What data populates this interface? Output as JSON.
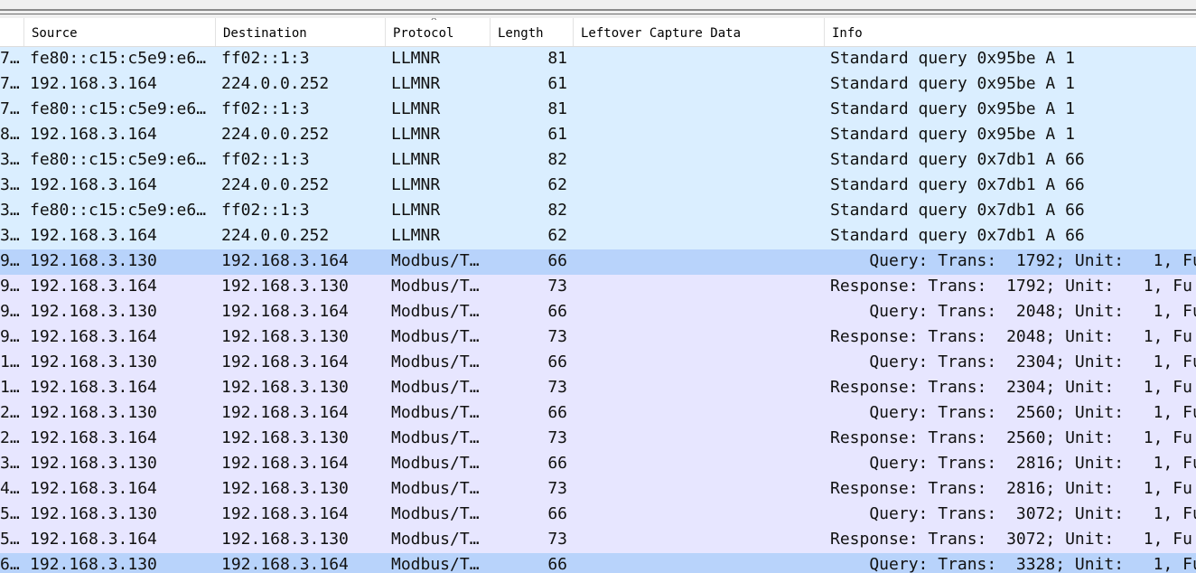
{
  "columns": {
    "no": "",
    "source": "Source",
    "destination": "Destination",
    "protocol": "Protocol",
    "length": "Length",
    "leftover": "Leftover Capture Data",
    "info": "Info"
  },
  "sort_indicator": "^",
  "colors": {
    "llmnr_row": "#daeeff",
    "modbus_row": "#e7e6ff",
    "selected_row": "#b8d3fb"
  },
  "rows": [
    {
      "no": "7…",
      "source": "fe80::c15:c5e9:e6…",
      "destination": "ff02::1:3",
      "protocol": "LLMNR",
      "length": "81",
      "leftover": "",
      "info": "Standard query 0x95be A 1",
      "kind": "llmnr"
    },
    {
      "no": "7…",
      "source": "192.168.3.164",
      "destination": "224.0.0.252",
      "protocol": "LLMNR",
      "length": "61",
      "leftover": "",
      "info": "Standard query 0x95be A 1",
      "kind": "llmnr"
    },
    {
      "no": "7…",
      "source": "fe80::c15:c5e9:e6…",
      "destination": "ff02::1:3",
      "protocol": "LLMNR",
      "length": "81",
      "leftover": "",
      "info": "Standard query 0x95be A 1",
      "kind": "llmnr"
    },
    {
      "no": "8…",
      "source": "192.168.3.164",
      "destination": "224.0.0.252",
      "protocol": "LLMNR",
      "length": "61",
      "leftover": "",
      "info": "Standard query 0x95be A 1",
      "kind": "llmnr"
    },
    {
      "no": "3…",
      "source": "fe80::c15:c5e9:e6…",
      "destination": "ff02::1:3",
      "protocol": "LLMNR",
      "length": "82",
      "leftover": "",
      "info": "Standard query 0x7db1 A 66",
      "kind": "llmnr"
    },
    {
      "no": "3…",
      "source": "192.168.3.164",
      "destination": "224.0.0.252",
      "protocol": "LLMNR",
      "length": "62",
      "leftover": "",
      "info": "Standard query 0x7db1 A 66",
      "kind": "llmnr"
    },
    {
      "no": "3…",
      "source": "fe80::c15:c5e9:e6…",
      "destination": "ff02::1:3",
      "protocol": "LLMNR",
      "length": "82",
      "leftover": "",
      "info": "Standard query 0x7db1 A 66",
      "kind": "llmnr"
    },
    {
      "no": "3…",
      "source": "192.168.3.164",
      "destination": "224.0.0.252",
      "protocol": "LLMNR",
      "length": "62",
      "leftover": "",
      "info": "Standard query 0x7db1 A 66",
      "kind": "llmnr"
    },
    {
      "no": "9…",
      "source": "192.168.3.130",
      "destination": "192.168.3.164",
      "protocol": "Modbus/T…",
      "length": "66",
      "leftover": "",
      "info": "    Query: Trans:  1792; Unit:   1, Fu",
      "kind": "selected"
    },
    {
      "no": "9…",
      "source": "192.168.3.164",
      "destination": "192.168.3.130",
      "protocol": "Modbus/T…",
      "length": "73",
      "leftover": "",
      "info": "Response: Trans:  1792; Unit:   1, Fu",
      "kind": "modbus"
    },
    {
      "no": "9…",
      "source": "192.168.3.130",
      "destination": "192.168.3.164",
      "protocol": "Modbus/T…",
      "length": "66",
      "leftover": "",
      "info": "    Query: Trans:  2048; Unit:   1, Fu",
      "kind": "modbus"
    },
    {
      "no": "9…",
      "source": "192.168.3.164",
      "destination": "192.168.3.130",
      "protocol": "Modbus/T…",
      "length": "73",
      "leftover": "",
      "info": "Response: Trans:  2048; Unit:   1, Fu",
      "kind": "modbus"
    },
    {
      "no": "1…",
      "source": "192.168.3.130",
      "destination": "192.168.3.164",
      "protocol": "Modbus/T…",
      "length": "66",
      "leftover": "",
      "info": "    Query: Trans:  2304; Unit:   1, Fu",
      "kind": "modbus"
    },
    {
      "no": "1…",
      "source": "192.168.3.164",
      "destination": "192.168.3.130",
      "protocol": "Modbus/T…",
      "length": "73",
      "leftover": "",
      "info": "Response: Trans:  2304; Unit:   1, Fu",
      "kind": "modbus"
    },
    {
      "no": "2…",
      "source": "192.168.3.130",
      "destination": "192.168.3.164",
      "protocol": "Modbus/T…",
      "length": "66",
      "leftover": "",
      "info": "    Query: Trans:  2560; Unit:   1, Fu",
      "kind": "modbus"
    },
    {
      "no": "2…",
      "source": "192.168.3.164",
      "destination": "192.168.3.130",
      "protocol": "Modbus/T…",
      "length": "73",
      "leftover": "",
      "info": "Response: Trans:  2560; Unit:   1, Fu",
      "kind": "modbus"
    },
    {
      "no": "3…",
      "source": "192.168.3.130",
      "destination": "192.168.3.164",
      "protocol": "Modbus/T…",
      "length": "66",
      "leftover": "",
      "info": "    Query: Trans:  2816; Unit:   1, Fu",
      "kind": "modbus"
    },
    {
      "no": "4…",
      "source": "192.168.3.164",
      "destination": "192.168.3.130",
      "protocol": "Modbus/T…",
      "length": "73",
      "leftover": "",
      "info": "Response: Trans:  2816; Unit:   1, Fu",
      "kind": "modbus"
    },
    {
      "no": "5…",
      "source": "192.168.3.130",
      "destination": "192.168.3.164",
      "protocol": "Modbus/T…",
      "length": "66",
      "leftover": "",
      "info": "    Query: Trans:  3072; Unit:   1, Fu",
      "kind": "modbus"
    },
    {
      "no": "5…",
      "source": "192.168.3.164",
      "destination": "192.168.3.130",
      "protocol": "Modbus/T…",
      "length": "73",
      "leftover": "",
      "info": "Response: Trans:  3072; Unit:   1, Fu",
      "kind": "modbus"
    },
    {
      "no": "6…",
      "source": "192.168.3.130",
      "destination": "192.168.3.164",
      "protocol": "Modbus/T…",
      "length": "66",
      "leftover": "",
      "info": "    Query: Trans:  3328; Unit:   1, Fu",
      "kind": "selected"
    }
  ]
}
